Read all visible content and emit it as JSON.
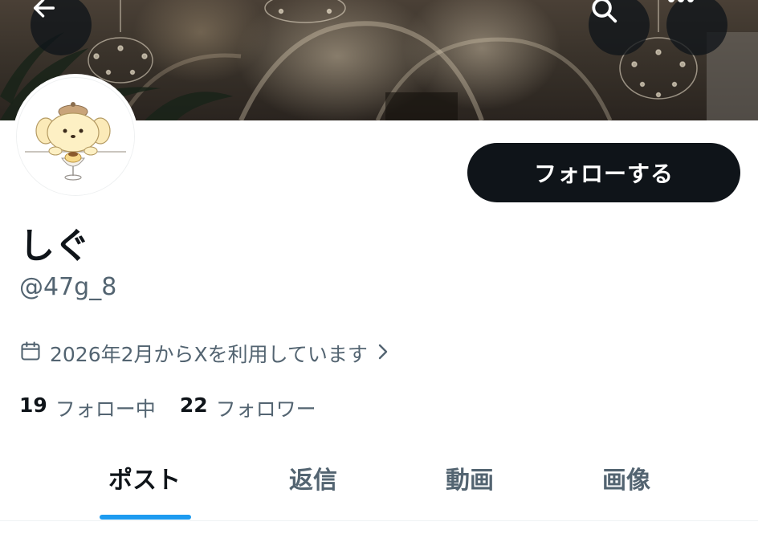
{
  "header": {
    "back_icon": "arrow-left-icon",
    "search_icon": "search-icon",
    "more_icon": "more-horizontal-icon"
  },
  "profile": {
    "display_name": "しぐ",
    "handle": "@47g_8",
    "joined_text": "2026年2月からXを利用しています",
    "follow_label": "フォローする"
  },
  "stats": {
    "following_count": "19",
    "following_label": "フォロー中",
    "followers_count": "22",
    "followers_label": "フォロワー"
  },
  "tabs": [
    {
      "label": "ポスト",
      "active": true
    },
    {
      "label": "返信",
      "active": false
    },
    {
      "label": "動画",
      "active": false
    },
    {
      "label": "画像",
      "active": false
    }
  ],
  "colors": {
    "accent": "#1d9bf0",
    "text_primary": "#0f1419",
    "text_secondary": "#536471"
  }
}
